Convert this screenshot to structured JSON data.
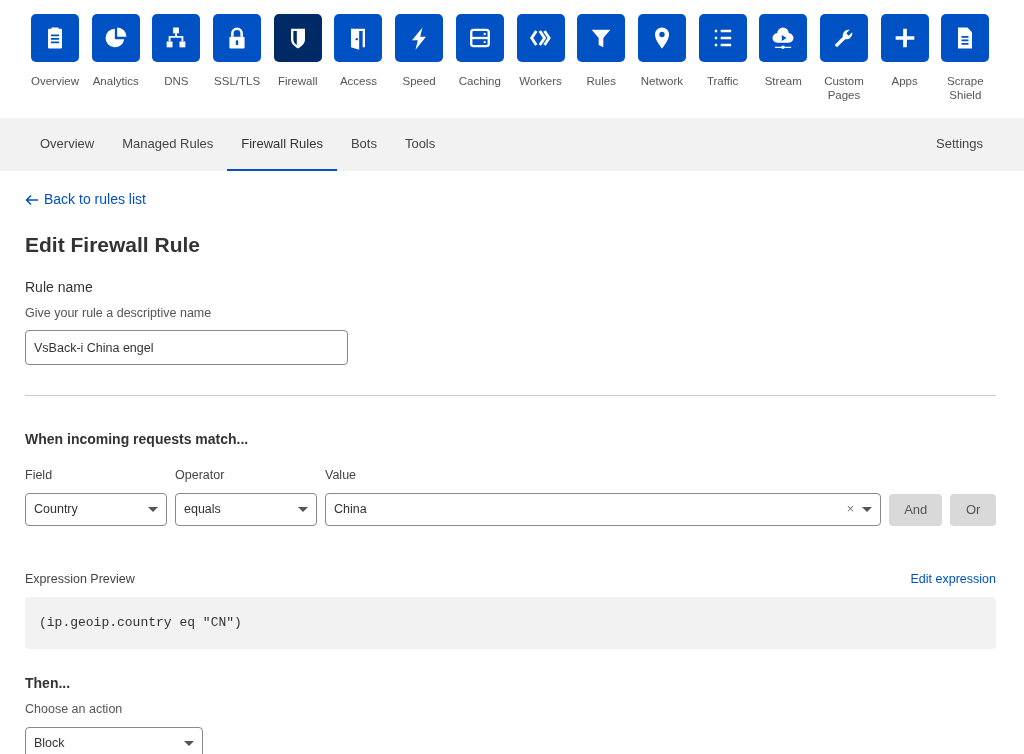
{
  "app_nav": [
    {
      "label": "Overview",
      "selected": false
    },
    {
      "label": "Analytics",
      "selected": false
    },
    {
      "label": "DNS",
      "selected": false
    },
    {
      "label": "SSL/TLS",
      "selected": false
    },
    {
      "label": "Firewall",
      "selected": true
    },
    {
      "label": "Access",
      "selected": false
    },
    {
      "label": "Speed",
      "selected": false
    },
    {
      "label": "Caching",
      "selected": false
    },
    {
      "label": "Workers",
      "selected": false
    },
    {
      "label": "Rules",
      "selected": false
    },
    {
      "label": "Network",
      "selected": false
    },
    {
      "label": "Traffic",
      "selected": false
    },
    {
      "label": "Stream",
      "selected": false
    },
    {
      "label": "Custom Pages",
      "selected": false
    },
    {
      "label": "Apps",
      "selected": false
    },
    {
      "label": "Scrape Shield",
      "selected": false
    }
  ],
  "sub_nav": {
    "tabs": [
      {
        "label": "Overview",
        "selected": false
      },
      {
        "label": "Managed Rules",
        "selected": false
      },
      {
        "label": "Firewall Rules",
        "selected": true
      },
      {
        "label": "Bots",
        "selected": false
      },
      {
        "label": "Tools",
        "selected": false
      }
    ],
    "settings": "Settings"
  },
  "back_link": "Back to rules list",
  "title": "Edit Firewall Rule",
  "rule_name": {
    "label": "Rule name",
    "hint": "Give your rule a descriptive name",
    "value": "VsBack-i China engel"
  },
  "match": {
    "heading": "When incoming requests match...",
    "field": {
      "label": "Field",
      "value": "Country"
    },
    "operator": {
      "label": "Operator",
      "value": "equals"
    },
    "value": {
      "label": "Value",
      "value": "China",
      "clear": "×"
    },
    "buttons": [
      "And",
      "Or"
    ]
  },
  "preview": {
    "label": "Expression Preview",
    "edit_link": "Edit expression",
    "expression": "(ip.geoip.country eq \"CN\")"
  },
  "then": {
    "heading": "Then...",
    "hint": "Choose an action",
    "action": "Block"
  }
}
